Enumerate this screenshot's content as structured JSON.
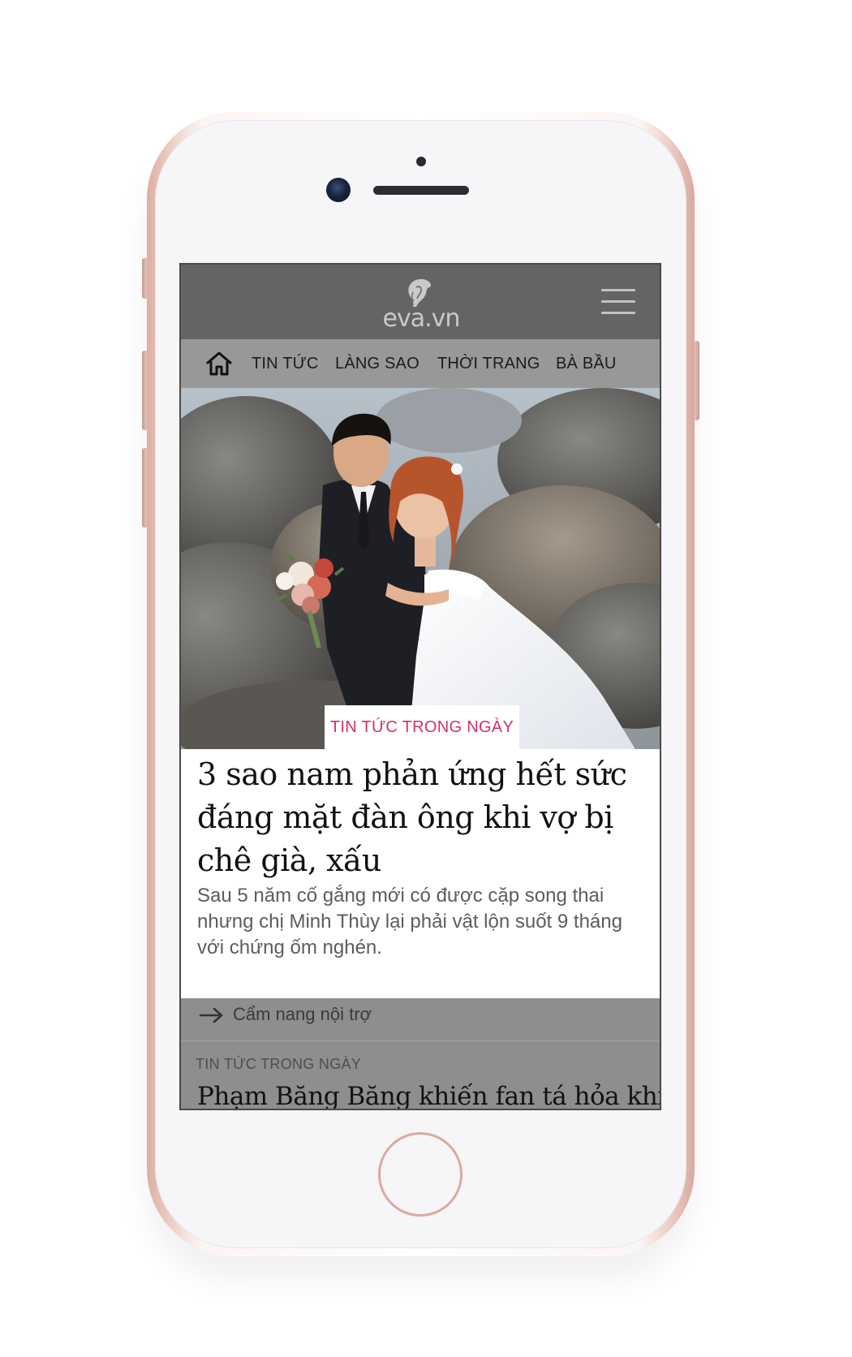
{
  "brand": {
    "logo_text": "eva.vn"
  },
  "icons": {
    "home": "home-icon",
    "menu": "hamburger-menu-icon",
    "related": "arrow-right-icon",
    "logo": "woman-silhouette-logo"
  },
  "nav": {
    "items": [
      {
        "label": "TIN TỨC"
      },
      {
        "label": "LÀNG SAO"
      },
      {
        "label": "THỜI TRANG"
      },
      {
        "label": "BÀ BẦU"
      }
    ]
  },
  "article": {
    "category": "TIN TỨC TRONG NGÀY",
    "title": "3 sao nam phản ứng hết sức đáng mặt đàn ông khi vợ bị chê già, xấu",
    "summary": "Sau 5 năm cố gắng mới có được cặp song thai nhưng chị Minh Thùy lại phải vật lộn suốt 9 tháng với chứng ốm nghén.",
    "related_link": "Cẩm nang nội trợ"
  },
  "next_article": {
    "category": "TIN TỨC TRONG NGÀY",
    "title": "Phạm Băng Băng khiến fan tá hỏa khi"
  },
  "colors": {
    "header_bg": "#646464",
    "nav_bg": "#989898",
    "category_accent": "#d2306e",
    "phone_frame": "#e9c4bb"
  }
}
